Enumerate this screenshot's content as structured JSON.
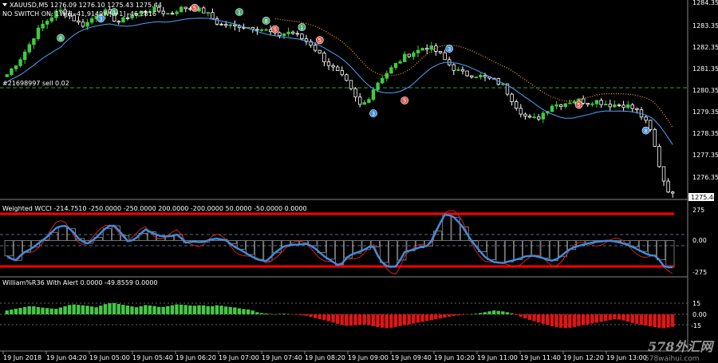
{
  "header": {
    "symbol_line": "XAUUSD,M5  1276.09 1276.10 1275.43 1275.44",
    "indicator_line": "NO SWITCH ON: 1W[i] -41,9149W[i+1] -46,2816",
    "order_label": "#21698997 sell 0.02"
  },
  "panes": {
    "cci_label": "Weighted WCCI -214.7510 -250.0000 -250.0000 200.0000 -200.0000 50.0000 -50.0000 0.0000",
    "wpr_label": "William%R36 With Alert 0.0000 -49.8559 0.0000"
  },
  "price_axis": {
    "labels": [
      "1284.35",
      "1283.35",
      "1282.35",
      "1281.35",
      "1280.35",
      "1279.35",
      "1278.35",
      "1277.35",
      "1276.35"
    ],
    "current_price": "1275.44"
  },
  "cci_axis": {
    "labels": [
      "275",
      "0.00",
      "-275"
    ]
  },
  "wpr_axis": {
    "labels": [
      "15",
      "0.00",
      "-15"
    ]
  },
  "time_axis": {
    "labels": [
      "19 Jun 2018",
      "19 Jun 04:20",
      "19 Jun 05:00",
      "19 Jun 05:40",
      "19 Jun 06:20",
      "19 Jun 07:00",
      "19 Jun 07:40",
      "19 Jun 08:20",
      "19 Jun 09:00",
      "19 Jun 09:40",
      "19 Jun 10:20",
      "19 Jun 11:00",
      "19 Jun 11:40",
      "19 Jun 12:20",
      "19 Jun 13:00"
    ]
  },
  "watermark": {
    "text": "578外汇网",
    "url": "578waihui.com"
  },
  "colors": {
    "bull": "#3ecc3e",
    "bear": "#ffffff",
    "ma_blue": "#4aa3ff",
    "ma_orange": "#ff9e1a",
    "cci_main": "#3d8fe0",
    "cci_signal": "#d62020",
    "level_red": "#ff0000",
    "hist_green": "#46c646",
    "hist_red": "#e01515",
    "grid_dash": "#5a6a8a",
    "marker_green": "#3ea86a",
    "marker_red": "#d9564b",
    "marker_blue": "#3e8bd9"
  },
  "chart_data": {
    "type": "candlestick",
    "price_range": [
      1274.9,
      1284.6
    ],
    "cci_range": [
      -330,
      330
    ],
    "wpr_range": [
      -35,
      35
    ],
    "price_path": [
      1281.0,
      1281.4,
      1281.8,
      1282.3,
      1282.9,
      1283.3,
      1283.6,
      1283.9,
      1284.0,
      1283.7,
      1283.4,
      1283.3,
      1283.6,
      1283.9,
      1283.9,
      1283.6,
      1283.4,
      1283.7,
      1283.8,
      1283.9,
      1284.0,
      1284.0,
      1283.9,
      1283.8,
      1284.0,
      1284.1,
      1284.1,
      1284.0,
      1283.9,
      1283.6,
      1283.3,
      1283.3,
      1283.2,
      1283.3,
      1283.2,
      1283.2,
      1283.1,
      1283.0,
      1282.8,
      1282.9,
      1283.0,
      1282.8,
      1282.6,
      1282.4,
      1282.0,
      1281.6,
      1281.3,
      1281.0,
      1280.6,
      1280.0,
      1279.5,
      1279.9,
      1280.5,
      1280.9,
      1281.2,
      1281.5,
      1281.8,
      1282.0,
      1282.1,
      1282.3,
      1282.2,
      1282.0,
      1281.6,
      1281.3,
      1281.1,
      1281.0,
      1281.0,
      1280.9,
      1280.8,
      1280.7,
      1280.5,
      1280.0,
      1279.5,
      1279.1,
      1278.9,
      1279.0,
      1279.3,
      1279.6,
      1279.6,
      1279.7,
      1279.8,
      1279.8,
      1279.7,
      1279.8,
      1279.7,
      1279.6,
      1279.6,
      1279.6,
      1279.5,
      1279.3,
      1278.9,
      1278.3,
      1276.9,
      1275.8,
      1275.4
    ],
    "cci_path": [
      -150,
      -200,
      -120,
      -80,
      -20,
      40,
      120,
      150,
      100,
      0,
      -30,
      30,
      110,
      160,
      80,
      -20,
      30,
      110,
      70,
      40,
      40,
      60,
      -20,
      -10,
      -20,
      10,
      20,
      0,
      -60,
      -100,
      -150,
      -190,
      -200,
      -120,
      -60,
      -40,
      -40,
      -30,
      -80,
      -150,
      -200,
      -250,
      -150,
      -120,
      -90,
      -40,
      -200,
      -260,
      -250,
      -110,
      -90,
      -60,
      -50,
      120,
      260,
      230,
      150,
      20,
      -80,
      -170,
      -210,
      -220,
      -200,
      -180,
      -150,
      -150,
      -170,
      -200,
      -170,
      -100,
      -60,
      -40,
      -20,
      -10,
      0,
      -10,
      -30,
      -60,
      -100,
      -140,
      -150,
      -260,
      -260
    ],
    "wpr_values": [
      5,
      7,
      9,
      11,
      9,
      8,
      7,
      10,
      13,
      12,
      11,
      9,
      13,
      15,
      13,
      11,
      9,
      12,
      11,
      9,
      11,
      13,
      12,
      11,
      12,
      10,
      12,
      10,
      9,
      7,
      6,
      2,
      1,
      0,
      1,
      0,
      -1,
      -2,
      -5,
      -7,
      -10,
      -13,
      -15,
      -14,
      -13,
      -15,
      -17,
      -18,
      -16,
      -14,
      -12,
      -10,
      -8,
      -6,
      -4,
      -2,
      -1,
      0,
      1,
      3,
      5,
      4,
      2,
      -2,
      -6,
      -9,
      -12,
      -15,
      -17,
      -18,
      -16,
      -14,
      -12,
      -10,
      -8,
      -6,
      -8,
      -11,
      -13,
      -15,
      -17,
      -18,
      -16
    ],
    "signal_markers": [
      {
        "label": "8",
        "kind": "green",
        "idx": 12,
        "price": 1282.7
      },
      {
        "label": "3",
        "kind": "blue",
        "idx": 21,
        "price": 1283.6
      },
      {
        "label": "1",
        "kind": "green",
        "idx": 24,
        "price": 1283.9
      },
      {
        "label": "5",
        "kind": "red",
        "idx": 42,
        "price": 1284.1
      },
      {
        "label": "1",
        "kind": "green",
        "idx": 52,
        "price": 1283.9
      },
      {
        "label": "8",
        "kind": "green",
        "idx": 58,
        "price": 1283.5
      },
      {
        "label": "5",
        "kind": "red",
        "idx": 60,
        "price": 1283.1
      },
      {
        "label": "1",
        "kind": "green",
        "idx": 66,
        "price": 1283.2
      },
      {
        "label": "5",
        "kind": "red",
        "idx": 70,
        "price": 1282.6
      },
      {
        "label": "3",
        "kind": "blue",
        "idx": 82,
        "price": 1279.2
      },
      {
        "label": "5",
        "kind": "red",
        "idx": 89,
        "price": 1279.8
      },
      {
        "label": "3",
        "kind": "blue",
        "idx": 99,
        "price": 1282.2
      },
      {
        "label": "5",
        "kind": "red",
        "idx": 128,
        "price": 1279.6
      },
      {
        "label": "8",
        "kind": "blue",
        "idx": 143,
        "price": 1278.4
      }
    ]
  }
}
